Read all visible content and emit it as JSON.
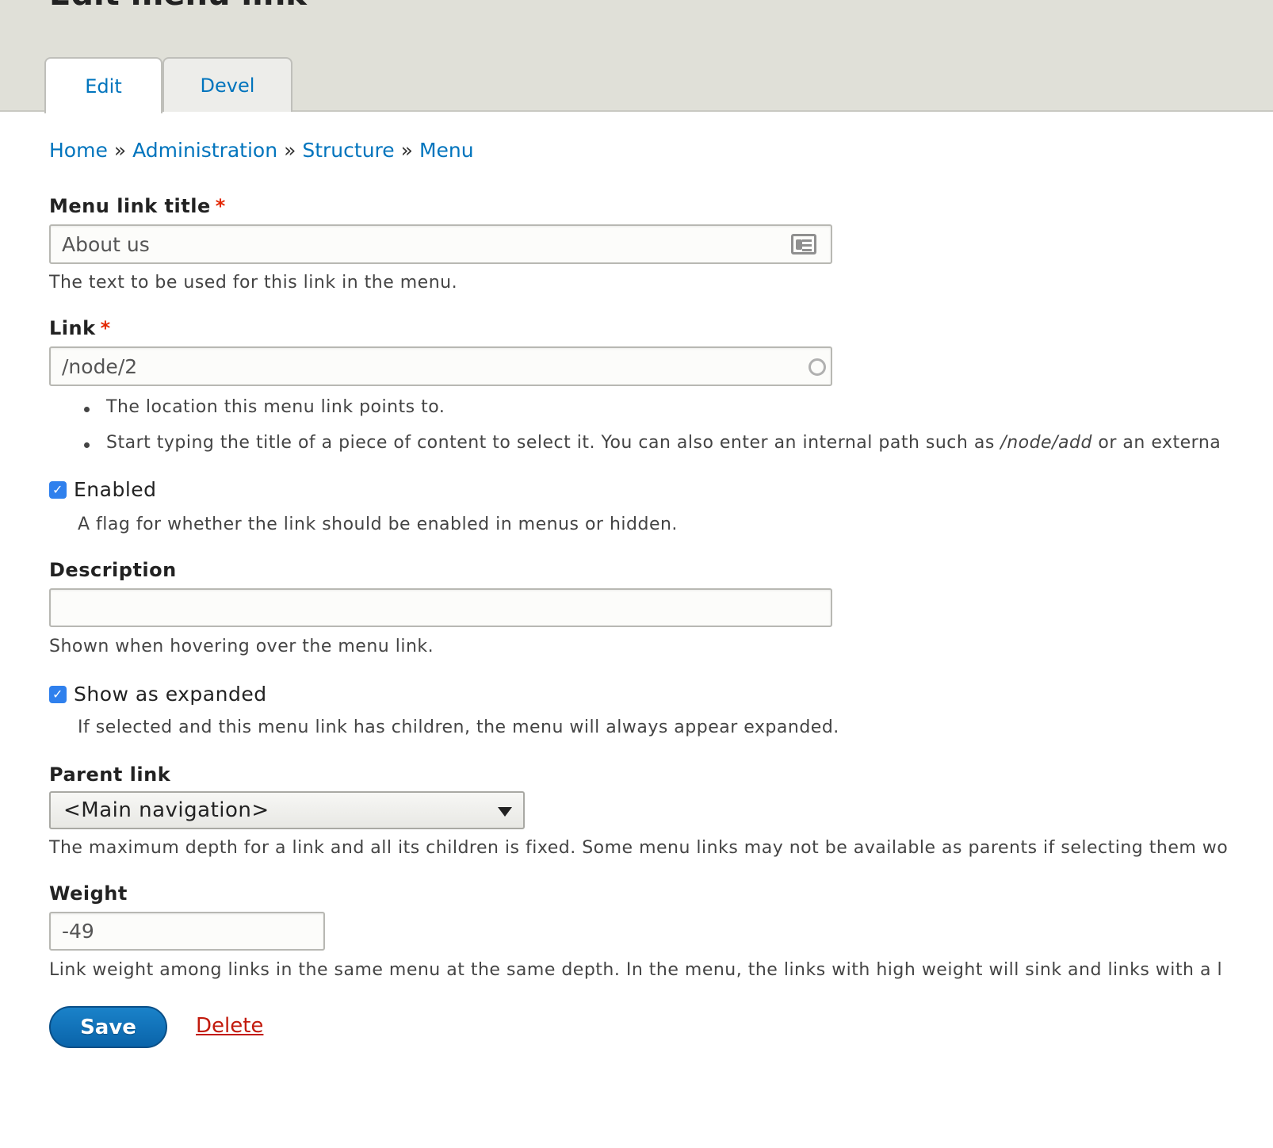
{
  "page": {
    "title": "Edit menu link"
  },
  "tabs": [
    {
      "label": "Edit",
      "active": true
    },
    {
      "label": "Devel",
      "active": false
    }
  ],
  "breadcrumb": {
    "items": [
      "Home",
      "Administration",
      "Structure",
      "Menu"
    ],
    "separator": "»"
  },
  "form": {
    "menu_link_title": {
      "label": "Menu link title",
      "required_marker": "*",
      "value": "About us",
      "description": "The text to be used for this link in the menu."
    },
    "link": {
      "label": "Link",
      "required_marker": "*",
      "value": "/node/2",
      "help_1": "The location this menu link points to.",
      "help_2_prefix": "Start typing the title of a piece of content to select it. You can also enter an internal path such as ",
      "help_2_em": "/node/add",
      "help_2_suffix": " or an externa"
    },
    "enabled": {
      "label": "Enabled",
      "checked": true,
      "description": "A flag for whether the link should be enabled in menus or hidden."
    },
    "description": {
      "label": "Description",
      "value": "",
      "description": "Shown when hovering over the menu link."
    },
    "expanded": {
      "label": "Show as expanded",
      "checked": true,
      "description": "If selected and this menu link has children, the menu will always appear expanded."
    },
    "parent_link": {
      "label": "Parent link",
      "selected": "<Main navigation>",
      "description": "The maximum depth for a link and all its children is fixed. Some menu links may not be available as parents if selecting them wo"
    },
    "weight": {
      "label": "Weight",
      "value": "-49",
      "description": "Link weight among links in the same menu at the same depth. In the menu, the links with high weight will sink and links with a l"
    }
  },
  "actions": {
    "save_label": "Save",
    "delete_label": "Delete"
  },
  "icons": {
    "title_field_icon": "contact-card-icon",
    "link_field_icon": "autocomplete-throbber-icon",
    "checkbox_check": "✓"
  },
  "colors": {
    "link": "#0074bd",
    "required": "#e32700",
    "primary_button": "#0a64aa",
    "delete": "#c21a0c",
    "header_bg": "#e0e0d8",
    "checkbox": "#2f80ed"
  }
}
